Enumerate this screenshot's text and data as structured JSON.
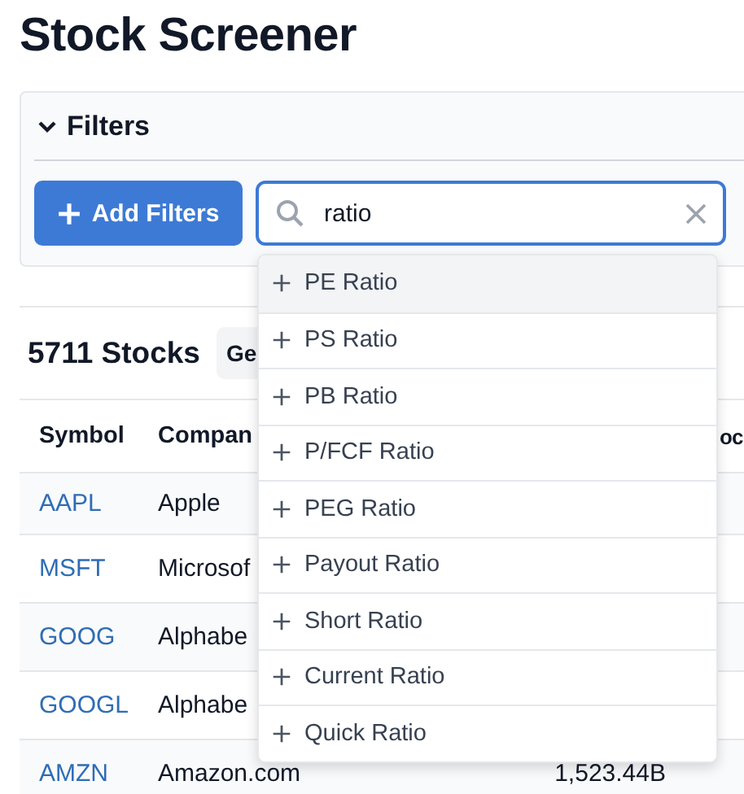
{
  "title": "Stock Screener",
  "filters": {
    "heading": "Filters",
    "expanded": true,
    "add_button": "Add Filters",
    "search": {
      "value": "ratio"
    },
    "suggestions": [
      {
        "label": "PE Ratio",
        "selected": true
      },
      {
        "label": "PS Ratio",
        "selected": false
      },
      {
        "label": "PB Ratio",
        "selected": false
      },
      {
        "label": "P/FCF Ratio",
        "selected": false
      },
      {
        "label": "PEG Ratio",
        "selected": false
      },
      {
        "label": "Payout Ratio",
        "selected": false
      },
      {
        "label": "Short Ratio",
        "selected": false
      },
      {
        "label": "Current Ratio",
        "selected": false
      },
      {
        "label": "Quick Ratio",
        "selected": false
      }
    ]
  },
  "results": {
    "count": "5711 Stocks",
    "view_button": "Ge"
  },
  "table": {
    "columns": [
      "Symbol",
      "Compan",
      "",
      "oc"
    ],
    "rows": [
      {
        "symbol": "AAPL",
        "company": "Apple"
      },
      {
        "symbol": "MSFT",
        "company": "Microsof"
      },
      {
        "symbol": "GOOG",
        "company": "Alphabe"
      },
      {
        "symbol": "GOOGL",
        "company": "Alphabe"
      },
      {
        "symbol": "AMZN",
        "company": "Amazon.com",
        "market_cap": "1,523.44B"
      }
    ]
  }
}
